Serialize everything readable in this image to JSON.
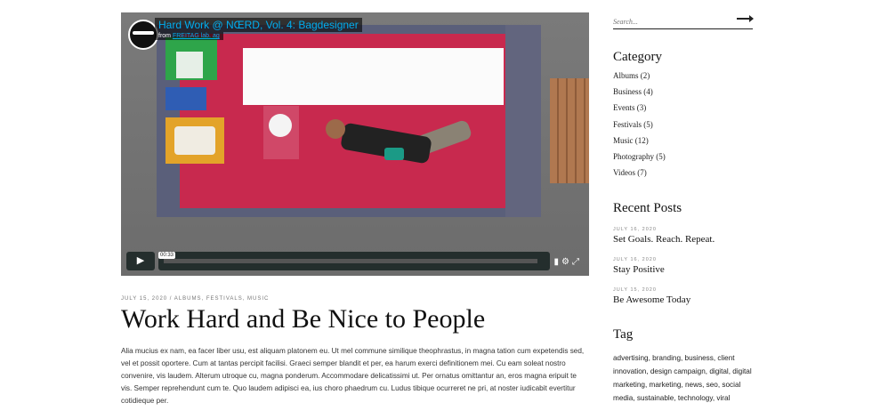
{
  "video": {
    "title": "Hard Work @ NŒRD, Vol. 4: Bagdesigner",
    "from_prefix": "from",
    "from_name": "FREITAG lab. ag",
    "time": "00:33",
    "progress": 0.0,
    "play_icon": "play-icon"
  },
  "post": {
    "meta": "JULY 15, 2020  /  ALBUMS, FESTIVALS, MUSIC",
    "title": "Work Hard and Be Nice to People",
    "body": "Alia mucius ex nam, ea facer liber usu, est aliquam platonem eu. Ut mel commune similique theophrastus, in magna tation cum expetendis sed, vel et possit oportere. Cum at tantas percipit facilisi. Graeci semper blandit et per, ea harum exerci definitionem mei. Cu eam soleat nostro convenire, vis laudem. Alterum utroque cu, magna ponderum. Accommodare delicatissimi ut. Per ornatus omittantur an, eros magna eripuit te vis. Semper reprehendunt cum te. Quo laudem adipisci ea, ius choro phaedrum cu. Ludus tibique ocurreret ne pri, at noster iudicabit evertitur cotidieque per."
  },
  "sidebar": {
    "search_placeholder": "Search...",
    "category_heading": "Category",
    "categories": [
      "Albums (2)",
      "Business (4)",
      "Events (3)",
      "Festivals (5)",
      "Music (12)",
      "Photography (5)",
      "Videos (7)"
    ],
    "recent_heading": "Recent Posts",
    "recent": [
      {
        "date": "JULY 16, 2020",
        "title": "Set Goals. Reach. Repeat."
      },
      {
        "date": "JULY 16, 2020",
        "title": "Stay Positive"
      },
      {
        "date": "JULY 15, 2020",
        "title": "Be Awesome Today"
      }
    ],
    "tag_heading": "Tag",
    "tags": "advertising, branding, business, client innovation, design campaign, digital, digital marketing, marketing, news, seo, social media, sustainable, technology, viral"
  },
  "colors": {
    "accent": "#00adef",
    "table": "#c8294e"
  }
}
